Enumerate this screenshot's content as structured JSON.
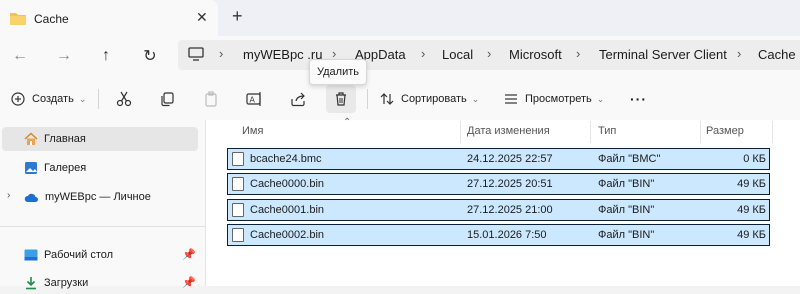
{
  "tab": {
    "title": "Cache",
    "close": "✕",
    "new": "+"
  },
  "breadcrumbs": [
    "myWEBpc .ru",
    "AppData",
    "Local",
    "Microsoft",
    "Terminal Server Client",
    "Cache"
  ],
  "tooltip": "Удалить",
  "commands": {
    "create": "Создать",
    "sort": "Сортировать",
    "view": "Просмотреть",
    "more": "···"
  },
  "sidebar": {
    "items": [
      {
        "label": "Главная",
        "icon": "home-icon",
        "selected": true
      },
      {
        "label": "Галерея",
        "icon": "gallery-icon"
      },
      {
        "label": "myWEBpc — Личное",
        "icon": "cloud-icon"
      },
      {
        "label": "Рабочий стол",
        "icon": "desktop-icon",
        "pinned": true
      },
      {
        "label": "Загрузки",
        "icon": "downloads-icon",
        "pinned": true
      }
    ]
  },
  "columns": [
    "Имя",
    "Дата изменения",
    "Тип",
    "Размер"
  ],
  "files": [
    {
      "name": "bcache24.bmc",
      "date": "24.12.2025 22:57",
      "type": "Файл \"BMC\"",
      "size": "0 КБ"
    },
    {
      "name": "Cache0000.bin",
      "date": "27.12.2025 20:51",
      "type": "Файл \"BIN\"",
      "size": "49 КБ"
    },
    {
      "name": "Cache0001.bin",
      "date": "27.12.2025 21:00",
      "type": "Файл \"BIN\"",
      "size": "49 КБ"
    },
    {
      "name": "Cache0002.bin",
      "date": "15.01.2026 7:50",
      "type": "Файл \"BIN\"",
      "size": "49 КБ"
    }
  ],
  "colors": {
    "selection": "#cce8ff",
    "selectionBorder": "#0b1f36",
    "folder": "#f4c542",
    "accent": "#1e6fd0"
  }
}
